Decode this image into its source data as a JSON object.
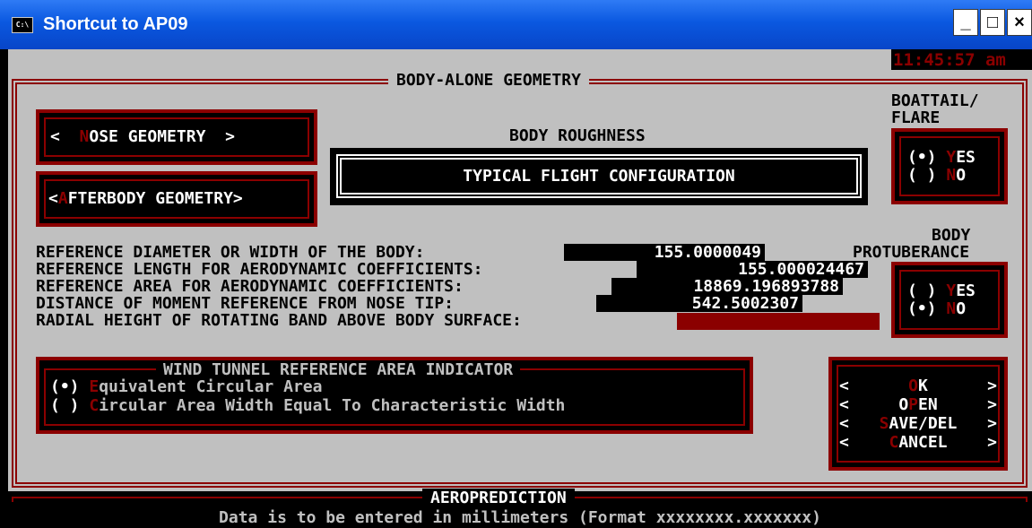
{
  "window": {
    "title": "Shortcut to AP09",
    "icon": "console-icon",
    "icon_text": "C:\\",
    "minimize": "_",
    "maximize": "□",
    "close": "×"
  },
  "clock": "11:45:57 am",
  "section_title": "BODY-ALONE GEOMETRY",
  "nose_button": {
    "prefix": "<  ",
    "hot": "N",
    "label": "OSE GEOMETRY",
    "suffix": "  >"
  },
  "afterbody_button": {
    "prefix": "<",
    "hot": "A",
    "label": "FTERBODY GEOMETRY",
    "suffix": ">"
  },
  "roughness": {
    "label": "BODY ROUGHNESS",
    "value": "TYPICAL FLIGHT CONFIGURATION"
  },
  "boattail": {
    "label1": "BOATTAIL/",
    "label2": "FLARE",
    "options": [
      {
        "mark": "(•) ",
        "hot": "Y",
        "rest": "ES",
        "selected": true
      },
      {
        "mark": "( ) ",
        "hot": "N",
        "rest": "O",
        "selected": false
      }
    ]
  },
  "protuberance": {
    "label1": "BODY",
    "label2": "PROTUBERANCE",
    "options": [
      {
        "mark": "( ) ",
        "hot": "Y",
        "rest": "ES",
        "selected": false
      },
      {
        "mark": "(•) ",
        "hot": "N",
        "rest": "O",
        "selected": true
      }
    ]
  },
  "fields": [
    {
      "label": "REFERENCE DIAMETER OR WIDTH OF THE BODY:",
      "value": "155.0000049"
    },
    {
      "label": "REFERENCE LENGTH FOR AERODYNAMIC COEFFICIENTS:",
      "value": "155.000024467"
    },
    {
      "label": "REFERENCE AREA FOR AERODYNAMIC COEFFICIENTS:",
      "value": "18869.196893788"
    },
    {
      "label": "DISTANCE OF MOMENT REFERENCE FROM NOSE TIP:",
      "value": "542.5002307"
    },
    {
      "label": "RADIAL HEIGHT OF ROTATING BAND ABOVE BODY SURFACE:",
      "value": ""
    }
  ],
  "wind_tunnel": {
    "title": "WIND TUNNEL REFERENCE AREA INDICATOR",
    "options": [
      {
        "mark": "(•) ",
        "hot": "E",
        "rest": "quivalent Circular Area",
        "selected": true
      },
      {
        "mark": "( ) ",
        "hot": "C",
        "rest": "ircular Area Width Equal To Characteristic Width",
        "selected": false
      }
    ]
  },
  "actions": [
    {
      "hot": "O",
      "rest": "K"
    },
    {
      "hot": "",
      "rest": "O",
      "hot2": "P",
      "rest2": "EN"
    },
    {
      "hot": "S",
      "rest": "AVE/DEL"
    },
    {
      "hot": "C",
      "rest": "ANCEL"
    }
  ],
  "footer": {
    "title": "AEROPREDICTION",
    "status": "Data is to be entered in millimeters (Format xxxxxxxx.xxxxxxx)"
  },
  "colors": {
    "background": "#c0c0c0",
    "accent": "#8b0000",
    "title_bar": "#0a58e0"
  }
}
